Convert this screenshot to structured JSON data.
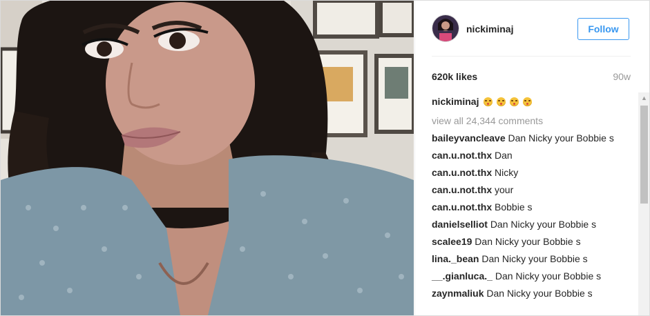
{
  "post": {
    "username": "nickiminaj",
    "follow_label": "Follow",
    "likes": "620k likes",
    "age": "90w",
    "caption": {
      "user": "nickiminaj",
      "emoji_icons": [
        "kissing-face-icon",
        "kissing-face-icon",
        "kissing-face-icon",
        "kissing-face-icon"
      ]
    },
    "view_all": "view all 24,344 comments",
    "comments": [
      {
        "user": "baileyvancleave",
        "text": "Dan Nicky your Bobbie s"
      },
      {
        "user": "can.u.not.thx",
        "text": "Dan"
      },
      {
        "user": "can.u.not.thx",
        "text": "Nicky"
      },
      {
        "user": "can.u.not.thx",
        "text": "your"
      },
      {
        "user": "can.u.not.thx",
        "text": "Bobbie s"
      },
      {
        "user": "danielselliot",
        "text": "Dan Nicky your Bobbie s"
      },
      {
        "user": "scalee19",
        "text": "Dan Nicky your Bobbie s"
      },
      {
        "user": "lina._bean",
        "text": "Dan Nicky your Bobbie s"
      },
      {
        "user": "__.gianluca._",
        "text": "Dan Nicky your Bobbie s"
      },
      {
        "user": "zaynmaliuk",
        "text": "Dan Nicky your Bobbie s"
      }
    ]
  },
  "colors": {
    "accent": "#3897f0",
    "text": "#262626",
    "muted": "#999999"
  }
}
